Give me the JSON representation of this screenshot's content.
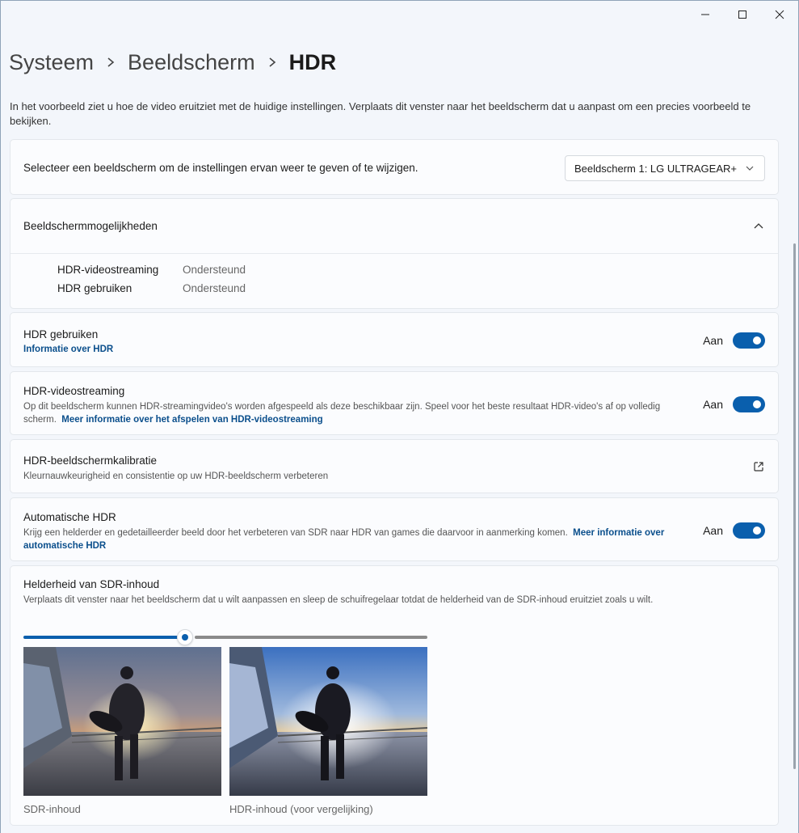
{
  "window": {
    "controls": [
      "minimize-icon",
      "maximize-icon",
      "close-icon"
    ]
  },
  "breadcrumb": {
    "items": [
      "Systeem",
      "Beeldscherm"
    ],
    "current": "HDR"
  },
  "intro_text": "In het voorbeeld ziet u hoe de video eruitziet met de huidige instellingen. Verplaats dit venster naar het beeldscherm dat u aanpast om een precies voorbeeld te bekijken.",
  "display_select": {
    "label": "Selecteer een beeldscherm om de instellingen ervan weer te geven of te wijzigen.",
    "value": "Beeldscherm 1: LG ULTRAGEAR+"
  },
  "capabilities": {
    "title": "Beeldschermmogelijkheden",
    "rows": [
      {
        "name": "HDR-videostreaming",
        "value": "Ondersteund"
      },
      {
        "name": "HDR gebruiken",
        "value": "Ondersteund"
      }
    ]
  },
  "use_hdr": {
    "title": "HDR gebruiken",
    "link": "Informatie over HDR",
    "state_label": "Aan",
    "on": true
  },
  "hdr_streaming": {
    "title": "HDR-videostreaming",
    "desc": "Op dit beeldscherm kunnen HDR-streamingvideo's worden afgespeeld als deze beschikbaar zijn. Speel voor het beste resultaat HDR-video's af op volledig scherm.",
    "link": "Meer informatie over het afspelen van HDR-videostreaming",
    "state_label": "Aan",
    "on": true
  },
  "calibration": {
    "title": "HDR-beeldschermkalibratie",
    "desc": "Kleurnauwkeurigheid en consistentie op uw HDR-beeldscherm verbeteren"
  },
  "auto_hdr": {
    "title": "Automatische HDR",
    "desc": "Krijg een helderder en gedetailleerder beeld door het verbeteren van SDR naar HDR van games die daarvoor in aanmerking komen.",
    "link": "Meer informatie over automatische HDR",
    "state_label": "Aan",
    "on": true
  },
  "sdr_brightness": {
    "title": "Helderheid van SDR-inhoud",
    "desc": "Verplaats dit venster naar het beeldscherm dat u wilt aanpassen en sleep de schuifregelaar totdat de helderheid van de SDR-inhoud eruitziet zoals u wilt.",
    "slider_fraction": 0.4,
    "preview_sdr_label": "SDR-inhoud",
    "preview_hdr_label": "HDR-inhoud (voor vergelijking)"
  },
  "colors": {
    "accent": "#0a5fad",
    "link": "#0b4f8c",
    "background": "#f3f6fb",
    "card": "#fbfcfe"
  }
}
